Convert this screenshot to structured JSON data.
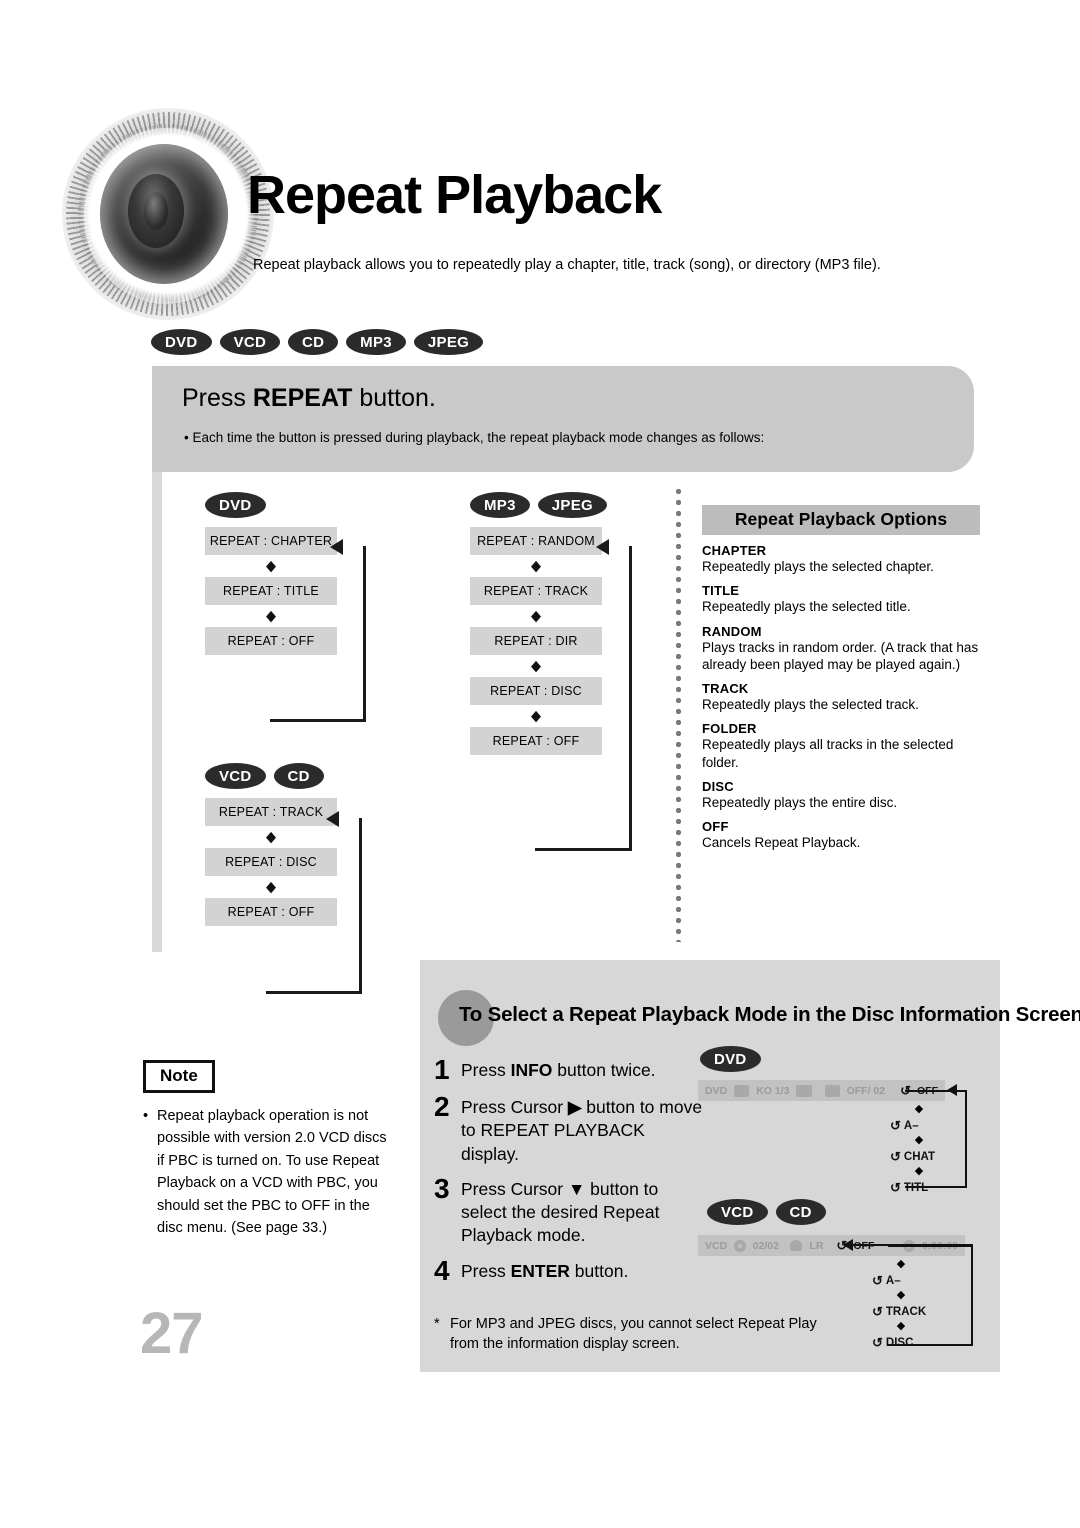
{
  "header": {
    "title": "Repeat Playback",
    "subtitle": "Repeat playback allows you to repeatedly play a chapter, title, track (song), or directory (MP3 file).",
    "disc_badges": [
      "DVD",
      "VCD",
      "CD",
      "MP3",
      "JPEG"
    ]
  },
  "press_panel": {
    "title_prefix": "Press ",
    "title_bold": "REPEAT",
    "title_suffix": " button.",
    "bullet": "• Each time the button is pressed during playback, the repeat playback mode changes as follows:"
  },
  "flows": [
    {
      "id": "dvd",
      "badges": [
        "DVD"
      ],
      "steps": [
        "REPEAT : CHAPTER",
        "REPEAT : TITLE",
        "REPEAT : OFF"
      ]
    },
    {
      "id": "vcd-cd",
      "badges": [
        "VCD",
        "CD"
      ],
      "steps": [
        "REPEAT : TRACK",
        "REPEAT : DISC",
        "REPEAT : OFF"
      ]
    },
    {
      "id": "mp3-jpeg",
      "badges": [
        "MP3",
        "JPEG"
      ],
      "steps": [
        "REPEAT : RANDOM",
        "REPEAT : TRACK",
        "REPEAT : DIR",
        "REPEAT : DISC",
        "REPEAT : OFF"
      ]
    }
  ],
  "options": {
    "heading": "Repeat Playback Options",
    "items": [
      {
        "term": "CHAPTER",
        "desc": "Repeatedly plays the selected chapter."
      },
      {
        "term": "TITLE",
        "desc": "Repeatedly plays the selected title."
      },
      {
        "term": "RANDOM",
        "desc": "Plays tracks in random order.\n(A track that has already been played may be played again.)"
      },
      {
        "term": "TRACK",
        "desc": "Repeatedly plays the selected track."
      },
      {
        "term": "FOLDER",
        "desc": "Repeatedly plays all tracks in the selected folder."
      },
      {
        "term": "DISC",
        "desc": "Repeatedly plays the entire disc."
      },
      {
        "term": "OFF",
        "desc": "Cancels Repeat Playback."
      }
    ]
  },
  "note": {
    "label": "Note",
    "bullet": "•",
    "text": "Repeat playback operation is not possible with version 2.0 VCD discs if PBC is turned on. To use Repeat Playback on a VCD with PBC, you should set the PBC to OFF in the disc menu. (See page 33.)"
  },
  "page_number": "27",
  "bottom": {
    "title": "To Select a Repeat Playback Mode in the Disc Information Screen",
    "steps": [
      {
        "num": "1",
        "pre": "Press ",
        "bold": "INFO",
        "post": " button twice."
      },
      {
        "num": "2",
        "pre": "Press Cursor ",
        "bold": "▶",
        "post": " button to move to REPEAT PLAYBACK display."
      },
      {
        "num": "3",
        "pre": "Press Cursor ",
        "bold": "▼",
        "post": " button to select the desired Repeat Playback mode."
      },
      {
        "num": "4",
        "pre": "Press ",
        "bold": "ENTER",
        "post": " button."
      }
    ],
    "footnote_star": "*",
    "footnote": "For MP3 and JPEG discs, you cannot select Repeat Play from the information display screen.",
    "dvd_screen": {
      "badges": [
        "DVD"
      ],
      "infobar": {
        "disc_label": "DVD",
        "fields": [
          "KO 1/3",
          "OFF/ 02"
        ],
        "repeat_value": "OFF"
      },
      "modes": [
        "A–",
        "CHAT",
        "TITL"
      ]
    },
    "vcd_screen": {
      "badges": [
        "VCD",
        "CD"
      ],
      "infobar": {
        "disc_label": "VCD",
        "fields": [
          "02/02",
          "LR"
        ],
        "repeat_value": "OFF",
        "time": "0:00:00"
      },
      "modes": [
        "A–",
        "TRACK",
        "DISC"
      ]
    }
  },
  "icons": {
    "arrow_down": "◆",
    "repeat_glyph": "↺"
  },
  "colors": {
    "panel_grey": "#c9c9c9",
    "box_grey": "#d3d3d3",
    "badge_dark": "#2b2b2b",
    "bottom_panel": "#d7d7d7",
    "page_num": "#b7b7b7"
  }
}
